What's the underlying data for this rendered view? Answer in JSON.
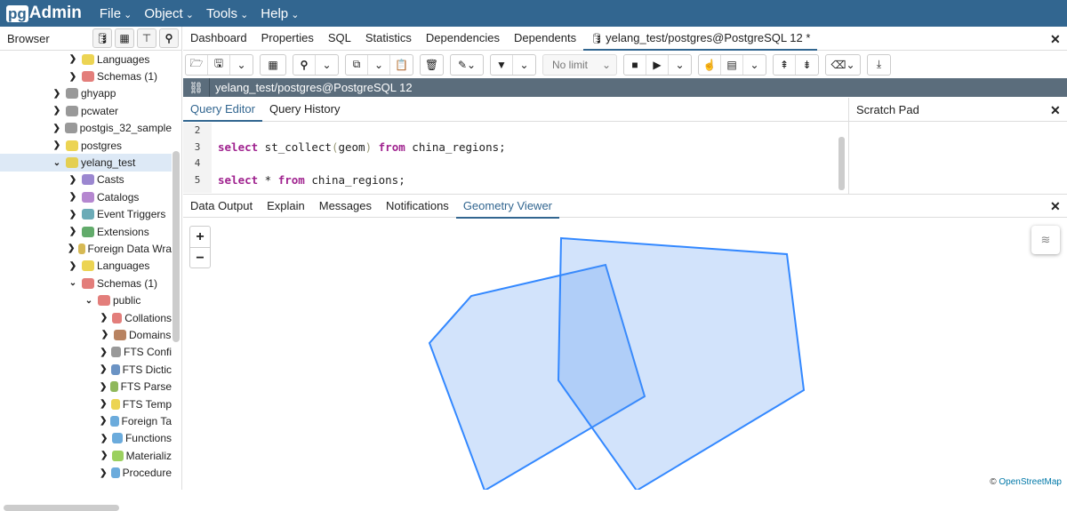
{
  "app": {
    "logo_pg": "pg",
    "logo_admin": "Admin"
  },
  "menus": [
    "File",
    "Object",
    "Tools",
    "Help"
  ],
  "browser": {
    "title": "Browser",
    "tree": [
      {
        "label": "Languages",
        "indent": 5,
        "chev": "›",
        "icon": "languages",
        "color": "#e6c619"
      },
      {
        "label": "Schemas (1)",
        "indent": 5,
        "chev": "›",
        "icon": "schemas",
        "color": "#d9534f"
      },
      {
        "label": "ghyapp",
        "indent": 4,
        "chev": "›",
        "icon": "database-disconnected",
        "color": "#777"
      },
      {
        "label": "pcwater",
        "indent": 4,
        "chev": "›",
        "icon": "database-disconnected",
        "color": "#777"
      },
      {
        "label": "postgis_32_sample",
        "indent": 4,
        "chev": "›",
        "icon": "database-disconnected",
        "color": "#777"
      },
      {
        "label": "postgres",
        "indent": 4,
        "chev": "›",
        "icon": "database",
        "color": "#e6c619"
      },
      {
        "label": "yelang_test",
        "indent": 4,
        "chev": "⌄",
        "icon": "database",
        "color": "#e6c619",
        "selected": true
      },
      {
        "label": "Casts",
        "indent": 5,
        "chev": "›",
        "icon": "casts",
        "color": "#7a5fc0"
      },
      {
        "label": "Catalogs",
        "indent": 5,
        "chev": "›",
        "icon": "catalogs",
        "color": "#9c5fc0"
      },
      {
        "label": "Event Triggers",
        "indent": 5,
        "chev": "›",
        "icon": "event-triggers",
        "color": "#3a8f9f"
      },
      {
        "label": "Extensions",
        "indent": 5,
        "chev": "›",
        "icon": "extensions",
        "color": "#2d8f3a"
      },
      {
        "label": "Foreign Data Wra",
        "indent": 5,
        "chev": "›",
        "icon": "foreign-data-wrappers",
        "color": "#c8a21b"
      },
      {
        "label": "Languages",
        "indent": 5,
        "chev": "›",
        "icon": "languages",
        "color": "#e6c619"
      },
      {
        "label": "Schemas (1)",
        "indent": 5,
        "chev": "⌄",
        "icon": "schemas",
        "color": "#d9534f"
      },
      {
        "label": "public",
        "indent": 6,
        "chev": "⌄",
        "icon": "schema",
        "color": "#d9534f"
      },
      {
        "label": "Collations",
        "indent": 7,
        "chev": "›",
        "icon": "collations",
        "color": "#d9534f"
      },
      {
        "label": "Domains",
        "indent": 7,
        "chev": "›",
        "icon": "domains",
        "color": "#a05a2c"
      },
      {
        "label": "FTS Confi",
        "indent": 7,
        "chev": "›",
        "icon": "fts-configurations",
        "color": "#777"
      },
      {
        "label": "FTS Dictic",
        "indent": 7,
        "chev": "›",
        "icon": "fts-dictionaries",
        "color": "#3a6fb0"
      },
      {
        "label": "FTS Parse",
        "indent": 7,
        "chev": "›",
        "icon": "fts-parsers",
        "color": "#6aa024"
      },
      {
        "label": "FTS Temp",
        "indent": 7,
        "chev": "›",
        "icon": "fts-templates",
        "color": "#e6c619"
      },
      {
        "label": "Foreign Ta",
        "indent": 7,
        "chev": "›",
        "icon": "foreign-tables",
        "color": "#3a8fd0"
      },
      {
        "label": "Functions",
        "indent": 7,
        "chev": "›",
        "icon": "functions",
        "color": "#3a8fd0"
      },
      {
        "label": "Materializ",
        "indent": 7,
        "chev": "›",
        "icon": "materialized-views",
        "color": "#7ac02a"
      },
      {
        "label": "Procedure",
        "indent": 7,
        "chev": "›",
        "icon": "procedures",
        "color": "#3a8fd0"
      }
    ]
  },
  "tabs": [
    {
      "label": "Dashboard"
    },
    {
      "label": "Properties"
    },
    {
      "label": "SQL"
    },
    {
      "label": "Statistics"
    },
    {
      "label": "Dependencies"
    },
    {
      "label": "Dependents"
    },
    {
      "label": "yelang_test/postgres@PostgreSQL 12 *",
      "active": true
    }
  ],
  "toolbar": {
    "limit": "No limit"
  },
  "connection": "yelang_test/postgres@PostgreSQL 12",
  "query_tabs": [
    "Query Editor",
    "Query History"
  ],
  "scratch_pad": "Scratch Pad",
  "editor": {
    "lines": [
      {
        "n": "2",
        "parts": []
      },
      {
        "n": "3",
        "parts": [
          {
            "t": "select",
            "k": "kw"
          },
          {
            "t": " st_collect"
          },
          {
            "t": "(",
            "k": "pn"
          },
          {
            "t": "geom"
          },
          {
            "t": ")",
            "k": "pn"
          },
          {
            "t": " "
          },
          {
            "t": "from",
            "k": "kw"
          },
          {
            "t": " china_regions;"
          }
        ]
      },
      {
        "n": "4",
        "parts": []
      },
      {
        "n": "5",
        "parts": [
          {
            "t": "select",
            "k": "kw"
          },
          {
            "t": " * "
          },
          {
            "t": "from",
            "k": "kw"
          },
          {
            "t": " china_regions;"
          }
        ]
      }
    ]
  },
  "output_tabs": [
    {
      "label": "Data Output"
    },
    {
      "label": "Explain"
    },
    {
      "label": "Messages"
    },
    {
      "label": "Notifications"
    },
    {
      "label": "Geometry Viewer",
      "active": true
    }
  ],
  "map": {
    "zoom_in": "+",
    "zoom_out": "−",
    "attribution_prefix": "©",
    "attribution_link": "OpenStreetMap",
    "polygon_fill": "#4d90f0",
    "polygon_stroke": "#3388ff"
  }
}
